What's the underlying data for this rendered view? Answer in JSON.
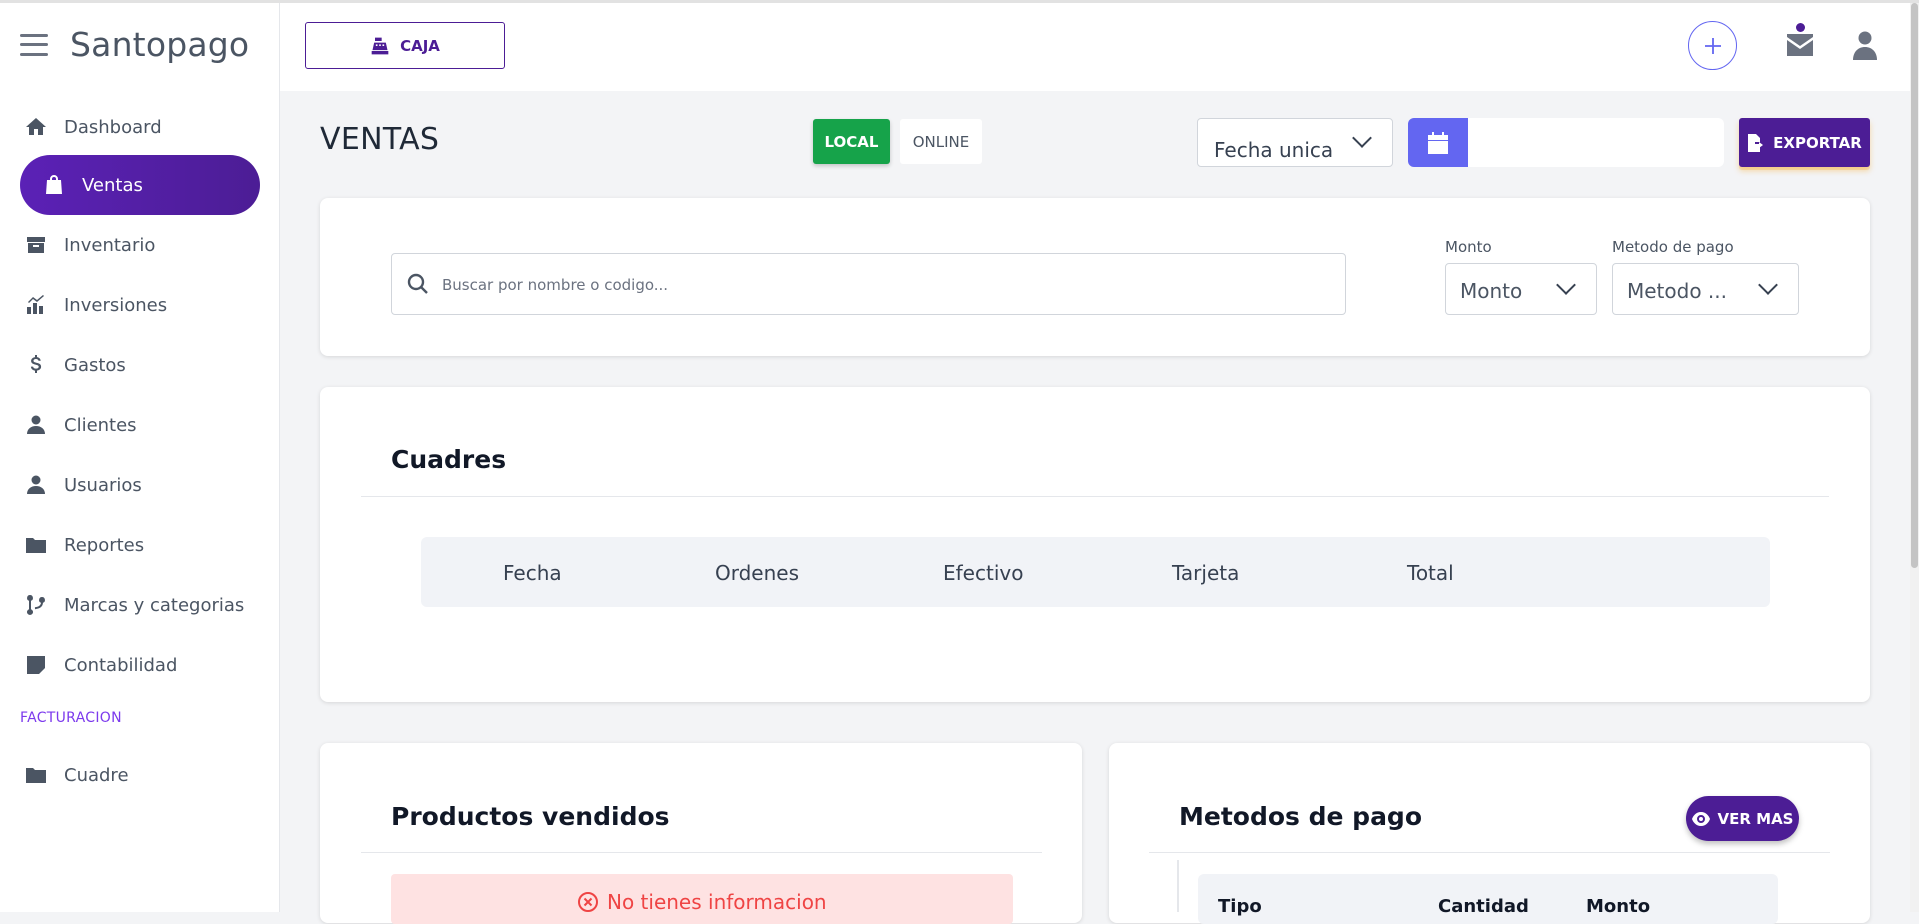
{
  "app": {
    "name": "Santopago"
  },
  "header": {
    "caja_label": "CAJA"
  },
  "sidebar": {
    "items": [
      {
        "label": "Dashboard",
        "icon": "home-icon"
      },
      {
        "label": "Ventas",
        "icon": "shopping-bag-icon",
        "active": true
      },
      {
        "label": "Inventario",
        "icon": "box-icon"
      },
      {
        "label": "Inversiones",
        "icon": "investment-icon"
      },
      {
        "label": "Gastos",
        "icon": "dollar-icon"
      },
      {
        "label": "Clientes",
        "icon": "user-icon"
      },
      {
        "label": "Usuarios",
        "icon": "user-icon"
      },
      {
        "label": "Reportes",
        "icon": "folder-icon"
      },
      {
        "label": "Marcas y categorias",
        "icon": "branch-icon"
      },
      {
        "label": "Contabilidad",
        "icon": "note-icon"
      }
    ],
    "section_label": "FACTURACION",
    "section_items": [
      {
        "label": "Cuadre",
        "icon": "folder-icon"
      }
    ]
  },
  "page": {
    "title": "VENTAS",
    "tab_local": "LOCAL",
    "tab_online": "ONLINE",
    "date_mode_value": "Fecha unica",
    "date_value": "",
    "export_label": "EXPORTAR"
  },
  "filters": {
    "search_placeholder": "Buscar por nombre o codigo...",
    "monto_label": "Monto",
    "monto_value": "Monto",
    "metodo_label": "Metodo de pago",
    "metodo_value": "Metodo ..."
  },
  "cuadres": {
    "title": "Cuadres",
    "columns": [
      "Fecha",
      "Ordenes",
      "Efectivo",
      "Tarjeta",
      "Total"
    ]
  },
  "productos": {
    "title": "Productos vendidos",
    "empty_message": "No tienes informacion"
  },
  "metodos": {
    "title": "Metodos de pago",
    "ver_mas_label": "VER MAS",
    "columns": [
      "Tipo",
      "Cantidad",
      "Monto"
    ]
  },
  "colors": {
    "brand": "#4c1d95",
    "local_tab": "#16a34a",
    "calendar_button": "#6366f1",
    "empty_alert_bg": "#fee2e2",
    "empty_alert_text": "#ef4444"
  }
}
